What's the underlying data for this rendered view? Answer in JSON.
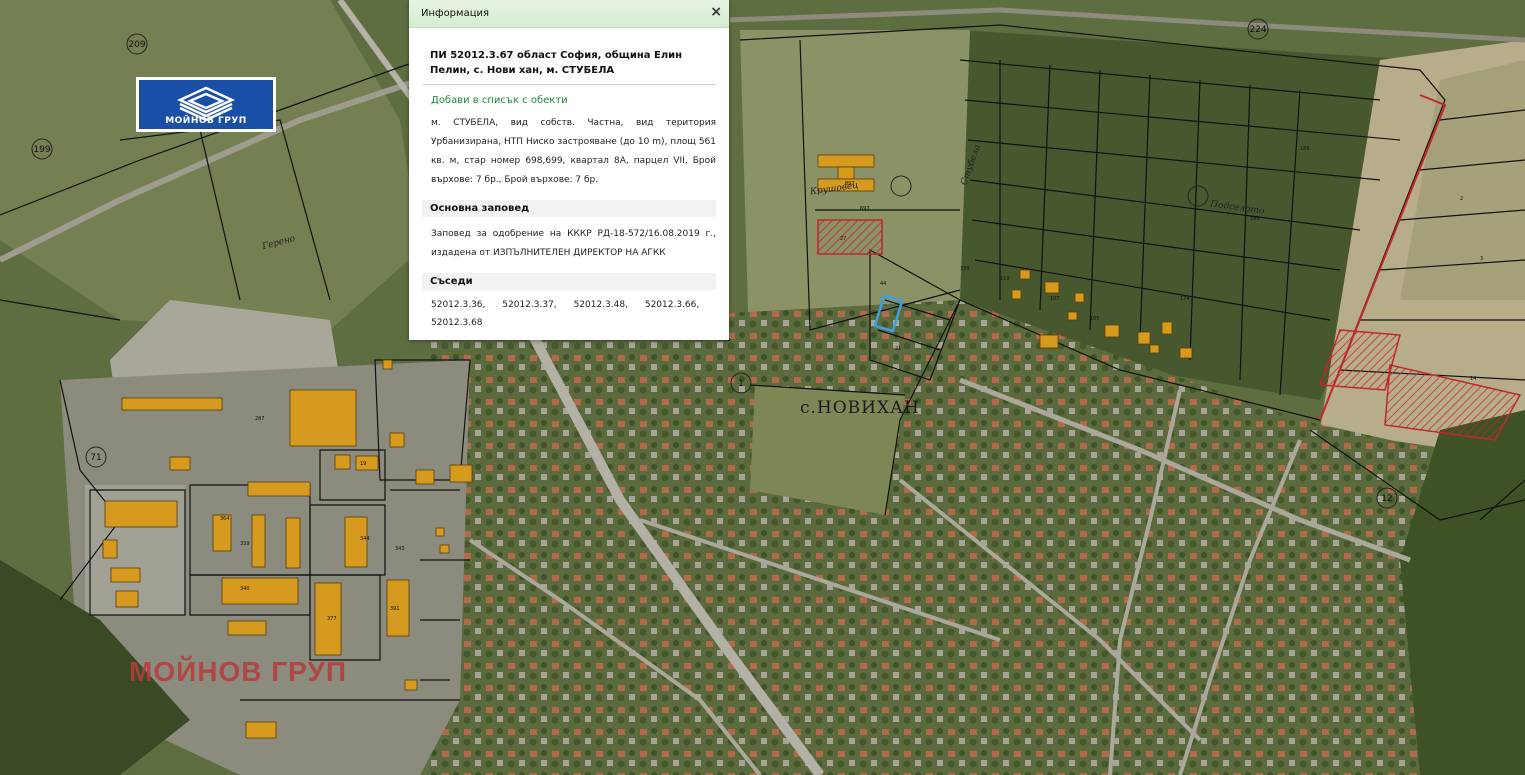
{
  "logo": {
    "text": "МОЙНОВ ГРУП"
  },
  "watermark": {
    "text": "МОЙНОВ ГРУП"
  },
  "map_labels": {
    "village": "с.НОВИХАН",
    "locality_stubela": "Стубела",
    "locality_podselata": "Подселото",
    "locality_gereno": "Герено",
    "locality_krusheta": "Крушовец",
    "parcel_numbers": [
      "209",
      "199",
      "71",
      "224",
      "1",
      "12"
    ]
  },
  "panel": {
    "title": "Информация",
    "close_symbol": "×",
    "heading": "ПИ 52012.3.67 област София, община Елин Пелин, с. Нови хан, м. СТУБЕЛА",
    "add_link": "Добави в списък с обекти",
    "description": "м. СТУБЕЛА, вид собств. Частна, вид територия Урбанизирана, НТП Ниско застрояване (до 10 m), площ 561 кв. м, стар номер 698,699, квартал 8А, парцел VII, Брой върхове: 7 бр., Брой върхове: 7 бр.",
    "order_title": "Основна заповед",
    "order_text": "Заповед за одобрение на КККР РД-18-572/16.08.2019 г., издадена от ИЗПЪЛНИТЕЛЕН ДИРЕКТОР НА АГКК",
    "neighbors_title": "Съседи",
    "neighbors": [
      "52012.3.36,",
      "52012.3.37,",
      "52012.3.48,",
      "52012.3.66,",
      "52012.3.68"
    ]
  },
  "colors": {
    "building": "#d69a1e",
    "parcel_line": "#111111",
    "hatched": "#c0282a",
    "selected": "#3aa0e0"
  }
}
